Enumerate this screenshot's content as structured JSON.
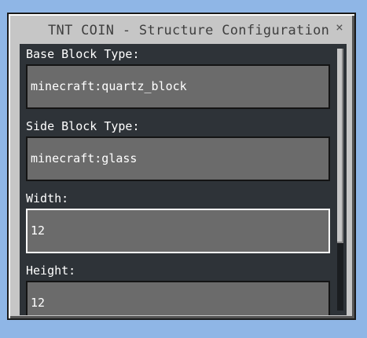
{
  "window": {
    "title": "TNT COIN - Structure Configuration",
    "close_icon": "close-icon",
    "close_glyph": "×"
  },
  "fields": [
    {
      "label": "Base Block Type:",
      "value": "minecraft:quartz_block"
    },
    {
      "label": "Side Block Type:",
      "value": "minecraft:glass"
    },
    {
      "label": "Width:",
      "value": "12"
    },
    {
      "label": "Height:",
      "value": "12"
    }
  ],
  "colors": {
    "window_bg": "#c6c6c6",
    "panel_bg": "#2e3338",
    "input_bg": "#6b6b6b",
    "desktop_bg": "#8fb6e6"
  }
}
